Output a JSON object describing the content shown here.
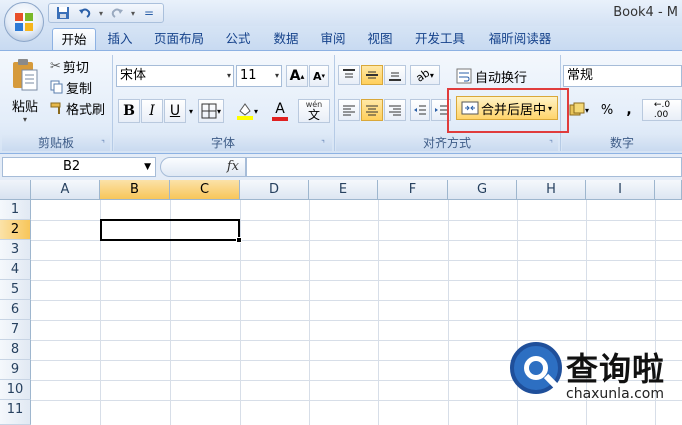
{
  "window": {
    "title": "Book4 - M"
  },
  "qat": {
    "save": "save-icon",
    "undo": "undo-icon",
    "redo": "redo-icon",
    "customize": "="
  },
  "tabs": [
    {
      "label": "开始",
      "active": true
    },
    {
      "label": "插入"
    },
    {
      "label": "页面布局"
    },
    {
      "label": "公式"
    },
    {
      "label": "数据"
    },
    {
      "label": "审阅"
    },
    {
      "label": "视图"
    },
    {
      "label": "开发工具"
    },
    {
      "label": "福昕阅读器"
    }
  ],
  "clipboard": {
    "paste": "粘贴",
    "cut": "剪切",
    "copy": "复制",
    "format_painter": "格式刷",
    "group": "剪贴板"
  },
  "font": {
    "name": "宋体",
    "size": "11",
    "bold": "B",
    "italic": "I",
    "underline": "U",
    "font_color_glyph": "A",
    "phonetic": "wén",
    "group": "字体"
  },
  "alignment": {
    "wrap_text": "自动换行",
    "merge_center": "合并后居中",
    "group": "对齐方式"
  },
  "number": {
    "format": "常规",
    "percent": "%",
    "comma": ",",
    "group": "数字"
  },
  "formula_bar": {
    "name_box": "B2",
    "fx": "fx",
    "value": ""
  },
  "grid": {
    "columns": [
      "A",
      "B",
      "C",
      "D",
      "E",
      "F",
      "G",
      "H",
      "I"
    ],
    "rows": [
      "1",
      "2",
      "3",
      "4",
      "5",
      "6",
      "7",
      "8",
      "9",
      "10",
      "11"
    ],
    "selected": "B2:C2"
  },
  "watermark": {
    "text": "查询啦",
    "url": "chaxunla.com"
  },
  "colors": {
    "accent": "#15428b",
    "highlight": "#e03c3c",
    "selected_header": "#f8c65a"
  }
}
